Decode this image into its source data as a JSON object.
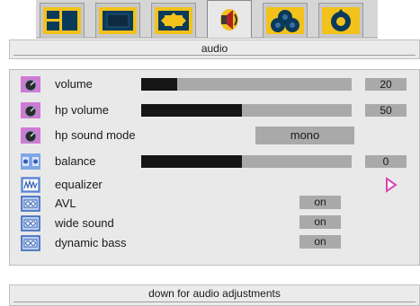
{
  "menu": {
    "tabs": [
      {
        "name": "picture-layout-icon"
      },
      {
        "name": "screen-icon"
      },
      {
        "name": "image-format-icon"
      },
      {
        "name": "speaker-icon"
      },
      {
        "name": "color-circles-icon"
      },
      {
        "name": "installation-icon"
      }
    ],
    "active_tab": 3
  },
  "title": "audio",
  "items": [
    {
      "label": "volume",
      "icon": "volume-knob-icon",
      "control": "slider",
      "level": 0.17,
      "value": "20"
    },
    {
      "label": "hp volume",
      "icon": "hp-volume-knob-icon",
      "control": "slider",
      "level": 0.48,
      "value": "50"
    },
    {
      "label": "hp sound mode",
      "icon": "hp-sound-mode-knob-icon",
      "control": "option",
      "value": "mono"
    },
    {
      "label": "balance",
      "icon": "balance-icon",
      "control": "slider",
      "level": 0.48,
      "value": "0"
    },
    {
      "label": "equalizer",
      "icon": "equalizer-icon",
      "control": "submenu",
      "value": ""
    },
    {
      "label": "AVL",
      "icon": "avl-icon",
      "control": "toggle",
      "value": "on"
    },
    {
      "label": "wide sound",
      "icon": "wide-sound-icon",
      "control": "toggle",
      "value": "on"
    },
    {
      "label": "dynamic bass",
      "icon": "dynamic-bass-icon",
      "control": "toggle",
      "value": "on"
    }
  ],
  "status": "down for audio adjustments",
  "colors": {
    "tab_icon_yellow": "#f2c21b",
    "tab_icon_dark": "#0a3a5a",
    "row_icon_pink": "#d07ad4",
    "row_icon_blue": "#2f5fb6",
    "arrow_pink": "#d946b4"
  }
}
